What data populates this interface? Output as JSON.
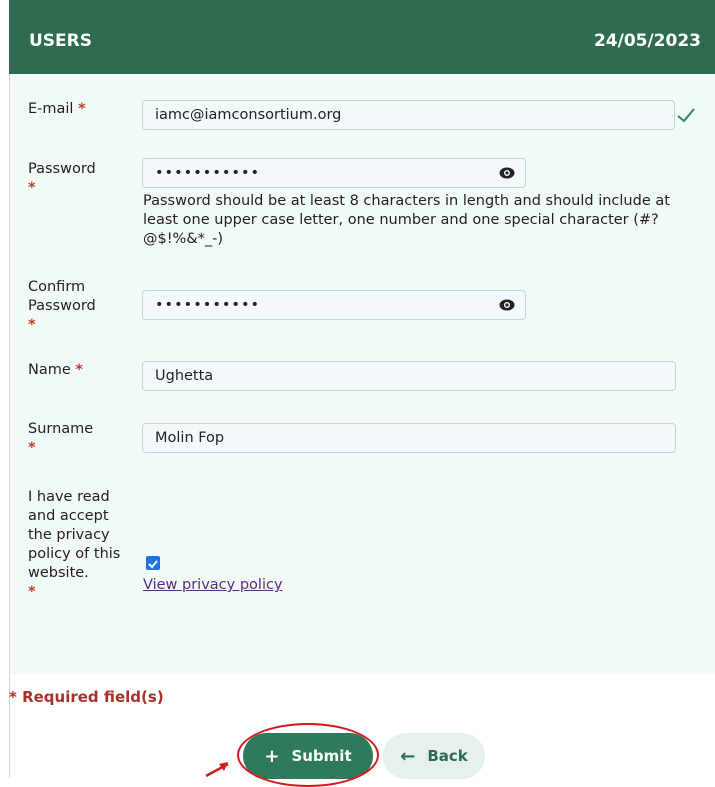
{
  "header": {
    "title": "USERS",
    "date": "24/05/2023"
  },
  "form": {
    "email": {
      "label": "E-mail",
      "value": "iamc@iamconsortium.org"
    },
    "password": {
      "label": "Password",
      "value": "•••••••••••",
      "hint": "Password should be at least 8 characters in length and should include at least one upper case letter, one number and one special character (#?@$!%&*_-)"
    },
    "confirm_password": {
      "label_line1": "Confirm",
      "label_line2": "Password",
      "value": "•••••••••••"
    },
    "name": {
      "label": "Name",
      "value": "Ughetta"
    },
    "surname": {
      "label": "Surname",
      "value": "Molin Fop"
    },
    "privacy": {
      "label": "I have read and accept the privacy policy of this website.",
      "checked": true,
      "link": "View privacy policy"
    },
    "required_mark": "*"
  },
  "required_note": "* Required field(s)",
  "buttons": {
    "submit": {
      "label": "Submit",
      "icon": "plus-icon"
    },
    "back": {
      "label": "Back",
      "icon": "arrow-left-icon"
    }
  },
  "colors": {
    "header": "#2f6b4f",
    "form_bg": "#f1faf6",
    "required": "#a8322a",
    "submit": "#2f7a5a",
    "annotation": "#d3191c"
  }
}
